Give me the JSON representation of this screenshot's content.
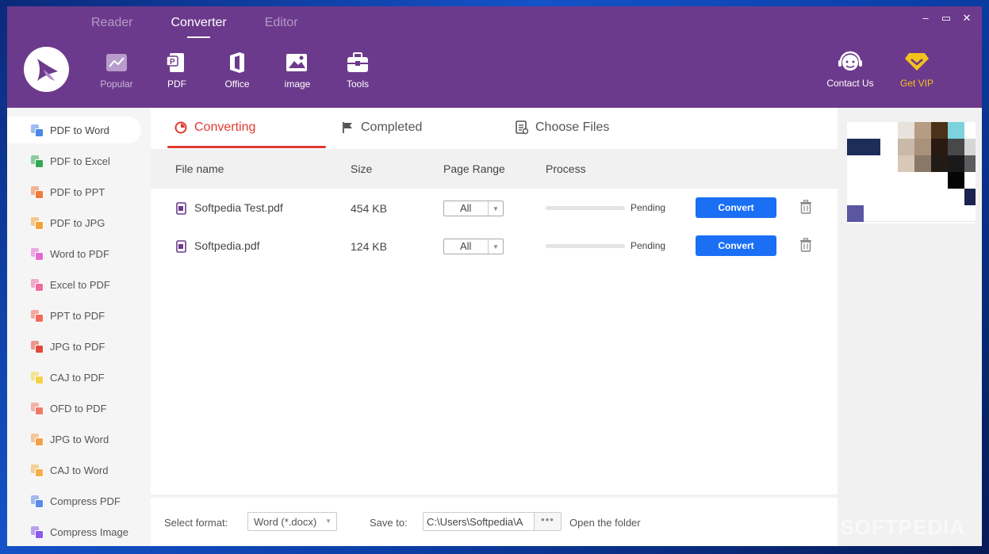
{
  "window": {
    "controls": {
      "minimize": "–",
      "maximize": "▭",
      "close": "✕"
    }
  },
  "top_tabs": [
    {
      "label": "Reader",
      "active": false
    },
    {
      "label": "Converter",
      "active": true
    },
    {
      "label": "Editor",
      "active": false
    }
  ],
  "toolbar": [
    {
      "label": "Popular",
      "icon": "chart-icon",
      "active": true
    },
    {
      "label": "PDF",
      "icon": "pdf-icon",
      "active": false
    },
    {
      "label": "Office",
      "icon": "office-icon",
      "active": false
    },
    {
      "label": "image",
      "icon": "image-icon",
      "active": false
    },
    {
      "label": "Tools",
      "icon": "toolbox-icon",
      "active": false
    }
  ],
  "right_tools": {
    "contact_label": "Contact Us",
    "vip_label": "Get VIP"
  },
  "sidebar": {
    "items": [
      {
        "label": "PDF to Word",
        "active": true,
        "color": "#4a86e8"
      },
      {
        "label": "PDF to Excel",
        "active": false,
        "color": "#34a853"
      },
      {
        "label": "PDF to PPT",
        "active": false,
        "color": "#f07a3c"
      },
      {
        "label": "PDF to JPG",
        "active": false,
        "color": "#f2a33a"
      },
      {
        "label": "Word to PDF",
        "active": false,
        "color": "#e46ad2"
      },
      {
        "label": "Excel to PDF",
        "active": false,
        "color": "#ef6aa1"
      },
      {
        "label": "PPT to PDF",
        "active": false,
        "color": "#f26a5a"
      },
      {
        "label": "JPG to PDF",
        "active": false,
        "color": "#e24a3a"
      },
      {
        "label": "CAJ to PDF",
        "active": false,
        "color": "#f3d24a"
      },
      {
        "label": "OFD to PDF",
        "active": false,
        "color": "#f07a6a"
      },
      {
        "label": "JPG to Word",
        "active": false,
        "color": "#f2a04a"
      },
      {
        "label": "CAJ to Word",
        "active": false,
        "color": "#f3b04a"
      },
      {
        "label": "Compress PDF",
        "active": false,
        "color": "#5a8ae8"
      },
      {
        "label": "Compress Image",
        "active": false,
        "color": "#8a5ae8"
      }
    ]
  },
  "tabs": [
    {
      "label": "Converting",
      "active": true
    },
    {
      "label": "Completed",
      "active": false
    },
    {
      "label": "Choose Files",
      "active": false
    }
  ],
  "table": {
    "headers": {
      "file_name": "File name",
      "size": "Size",
      "page_range": "Page Range",
      "process": "Process"
    },
    "rows": [
      {
        "file_name": "Softpedia Test.pdf",
        "size": "454 KB",
        "page_range": "All",
        "progress": 0,
        "status": "Pending",
        "action": "Convert"
      },
      {
        "file_name": "Softpedia.pdf",
        "size": "124 KB",
        "page_range": "All",
        "progress": 0,
        "status": "Pending",
        "action": "Convert"
      }
    ]
  },
  "bottom": {
    "select_format_label": "Select format:",
    "format_value": "Word (*.docx)",
    "save_to_label": "Save to:",
    "save_path": "C:\\Users\\Softpedia\\A",
    "more_label": "•••",
    "open_folder_label": "Open the folder"
  },
  "colors": {
    "header": "#6c3a8c",
    "accent_red": "#e03a2f",
    "button_blue": "#1a6ff5",
    "vip_yellow": "#f3c21b"
  },
  "watermark": "SOFTPEDIA"
}
